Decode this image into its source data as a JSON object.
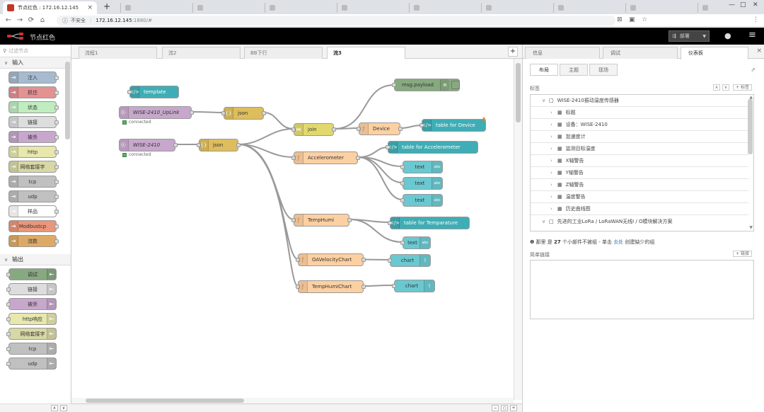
{
  "browser": {
    "active_tab_title": "节点红色 : 172.16.12.145",
    "other_tabs": [
      "",
      "",
      "",
      "",
      "",
      "",
      "",
      "",
      ""
    ],
    "security_label": "不安全",
    "url_host": "172.16.12.145",
    "url_path": ":1880/#"
  },
  "header": {
    "brand": "节点红色",
    "deploy_label": "部署"
  },
  "palette": {
    "filter_placeholder": "过滤节点",
    "categories": [
      {
        "label": "输入"
      },
      {
        "label": "输出"
      }
    ],
    "input_nodes": [
      {
        "label": "注入",
        "color": "#a6bbcf"
      },
      {
        "label": "抓住",
        "color": "#e49191"
      },
      {
        "label": "状态",
        "color": "#c0edc0"
      },
      {
        "label": "链接",
        "color": "#dddddd"
      },
      {
        "label": "被杀",
        "color": "#c7a8cc"
      },
      {
        "label": "http",
        "color": "#e7e7ae"
      },
      {
        "label": "网络套接字",
        "color": "#d8d8a5"
      },
      {
        "label": "tcp",
        "color": "#c0c0c0"
      },
      {
        "label": "udp",
        "color": "#c0c0c0"
      },
      {
        "label": "样品",
        "color": "#ffffff"
      },
      {
        "label": "Modbustcp",
        "color": "#e9967a"
      },
      {
        "label": "流数",
        "color": "#ddaa66"
      }
    ],
    "output_nodes": [
      {
        "label": "调试",
        "color": "#87a980"
      },
      {
        "label": "链接",
        "color": "#dddddd"
      },
      {
        "label": "被杀",
        "color": "#c7a8cc"
      },
      {
        "label": "http响应",
        "color": "#e7e7ae"
      },
      {
        "label": "网络套接字",
        "color": "#d8d8a5"
      },
      {
        "label": "tcp",
        "color": "#c0c0c0"
      },
      {
        "label": "udp",
        "color": "#c0c0c0"
      }
    ]
  },
  "workspace": {
    "tabs": [
      {
        "label": "流程1"
      },
      {
        "label": "流2"
      },
      {
        "label": "BB下行"
      },
      {
        "label": "流3"
      }
    ],
    "nodes": {
      "template": "template",
      "uplink": "WISE-2410_UpLink",
      "uplink_status": "connected",
      "wise": "WISE-2410",
      "wise_status": "connected",
      "json1": "json",
      "json2": "json",
      "join": "join",
      "msg": "msg.payload",
      "device": "Device",
      "table_device": "table for Device",
      "accel": "Accelerometer",
      "table_accel": "table for Accelerometer",
      "text1": "text",
      "text2": "text",
      "text3": "text",
      "temphumi": "TempHumi",
      "table_temp": "table for Temparature",
      "text4": "text",
      "oavel": "OAVelocityChart",
      "chart1": "chart",
      "temphumichart": "TempHumiChart",
      "chart2": "chart",
      "text_badge": "abc"
    }
  },
  "sidebar": {
    "tabs": [
      {
        "label": "信息"
      },
      {
        "label": "调试"
      },
      {
        "label": "仪表板"
      }
    ],
    "subtabs": [
      {
        "label": "布局"
      },
      {
        "label": "主题"
      },
      {
        "label": "现场"
      }
    ],
    "tabs_label": "标签",
    "add_tab": "+ 标签",
    "tree": [
      "WISE-2410振动温度传感器",
      "标题",
      "设备：WISE-2410",
      "加速度计",
      "监测目标温度",
      "X轴警告",
      "Y轴警告",
      "Z轴警告",
      "温度警告",
      "历史曲线图",
      "先进的工业LoRa / LoRaWAN无线I / O模块解决方案"
    ],
    "info_prefix": "那里 是",
    "info_count": "27",
    "info_mid": "个小部件不被组 - 单击",
    "info_link": "去处",
    "info_suffix": "创建缺少的组",
    "links_label": "简单链接",
    "add_link": "+ 链接"
  }
}
